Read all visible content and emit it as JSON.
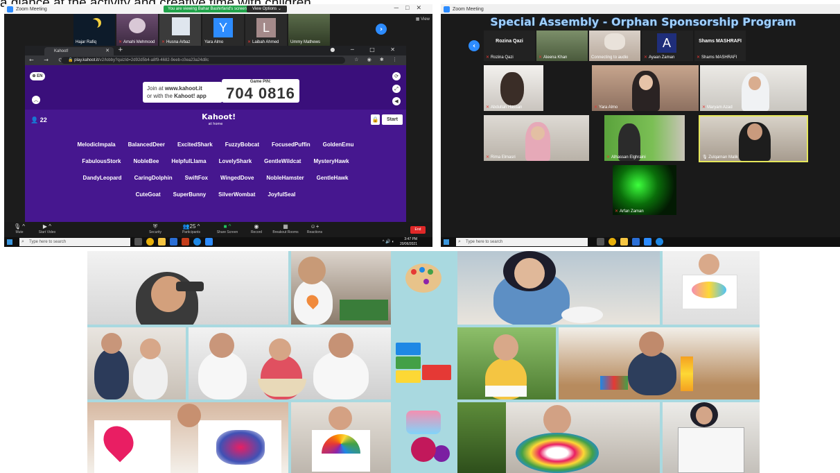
{
  "caption": "a glance at the activity and creative time with children ...",
  "zoom1": {
    "app_title": "Zoom Meeting",
    "viewing_banner": "You are viewing Bahar Bashirfarid's screen",
    "view_options": "View Options ⌄",
    "view_label": "View",
    "participants": [
      {
        "name": "Hajar Rafiq",
        "muted": false
      },
      {
        "name": "Amahi Mehmood",
        "muted": true
      },
      {
        "name": "Husna Arbaz",
        "muted": true
      },
      {
        "name": "Yara Almo",
        "muted": false,
        "initial": "Y"
      },
      {
        "name": "Laibah Ahmed",
        "muted": true,
        "initial": "L"
      },
      {
        "name": "Ummy Mathews",
        "muted": false
      }
    ],
    "browser": {
      "tab_title": "Kahoot!",
      "url_host": "play.kahoot.it",
      "url_path": "/v2/lobby?quizId=2d92d5b4-a8f9-4682-9eeb-c0ea23a24d8c"
    },
    "kahoot": {
      "language": "EN",
      "join_line1": "Join at",
      "join_site": "www.kahoot.it",
      "join_line2": "or with the",
      "join_app": "Kahoot! app",
      "pin_label": "Game PIN:",
      "game_pin": "704 0816",
      "player_count": "22",
      "logo": "Kahoot!",
      "logo_sub": "at home",
      "start_label": "Start",
      "nicknames": [
        "MelodicImpala",
        "BalancedDeer",
        "ExcitedShark",
        "FuzzyBobcat",
        "FocusedPuffin",
        "GoldenEmu",
        "FabulousStork",
        "NobleBee",
        "HelpfulLlama",
        "LovelyShark",
        "GentleWildcat",
        "MysteryHawk",
        "DandyLeopard",
        "CaringDolphin",
        "SwiftFox",
        "WingedDove",
        "NobleHamster",
        "GentleHawk",
        "CuteGoat",
        "SuperBunny",
        "SilverWombat",
        "JoyfulSeal"
      ]
    },
    "toolbar": [
      {
        "label": "Mute",
        "icon": "mic-icon"
      },
      {
        "label": "Start Video",
        "icon": "video-icon"
      },
      {
        "label": "Security",
        "icon": "shield-icon"
      },
      {
        "label": "Participants",
        "icon": "people-icon",
        "count": "25"
      },
      {
        "label": "Share Screen",
        "icon": "share-icon"
      },
      {
        "label": "Record",
        "icon": "record-icon"
      },
      {
        "label": "Breakout Rooms",
        "icon": "grid-icon"
      },
      {
        "label": "Reactions",
        "icon": "emoji-icon"
      }
    ],
    "end_label": "End",
    "taskbar": {
      "search_placeholder": "Type here to search",
      "time": "3:47 PM",
      "date": "20/06/2021"
    }
  },
  "zoom2": {
    "app_title": "Zoom Meeting",
    "title": "Special Assembly - Orphan Sponsorship Program",
    "thumb_participants": [
      {
        "name": "Rozina Qazi",
        "tile": "Rozina Qazi",
        "muted": true
      },
      {
        "name": "Aleena Khan",
        "muted": true
      },
      {
        "name": "Connecting to audio",
        "muted": false
      },
      {
        "name": "Ayaan Zaman",
        "muted": true,
        "initial": "A"
      },
      {
        "name": "Shams MASHRAFI",
        "tile": "Shams MASHRAFI",
        "muted": true
      }
    ],
    "video_participants": [
      {
        "name": "Abdullah Hassan",
        "muted": true
      },
      {
        "name": "Yara Almo",
        "muted": true
      },
      {
        "name": "Maryam Azad",
        "muted": true
      },
      {
        "name": "Rima Elmasri",
        "muted": true
      },
      {
        "name": "Alhassan Elghraini",
        "muted": true
      },
      {
        "name": "Zulqarnan Malik",
        "muted": false
      },
      {
        "name": "Arfan Zaman",
        "muted": true
      }
    ],
    "taskbar": {
      "search_placeholder": "Type here to search"
    }
  },
  "colors": {
    "kahoot_purple": "#46178f",
    "zoom_blue": "#2d8cff",
    "collage_background": "#a9d9e0",
    "title_blue": "#9fd0ff",
    "end_red": "#e02828"
  }
}
